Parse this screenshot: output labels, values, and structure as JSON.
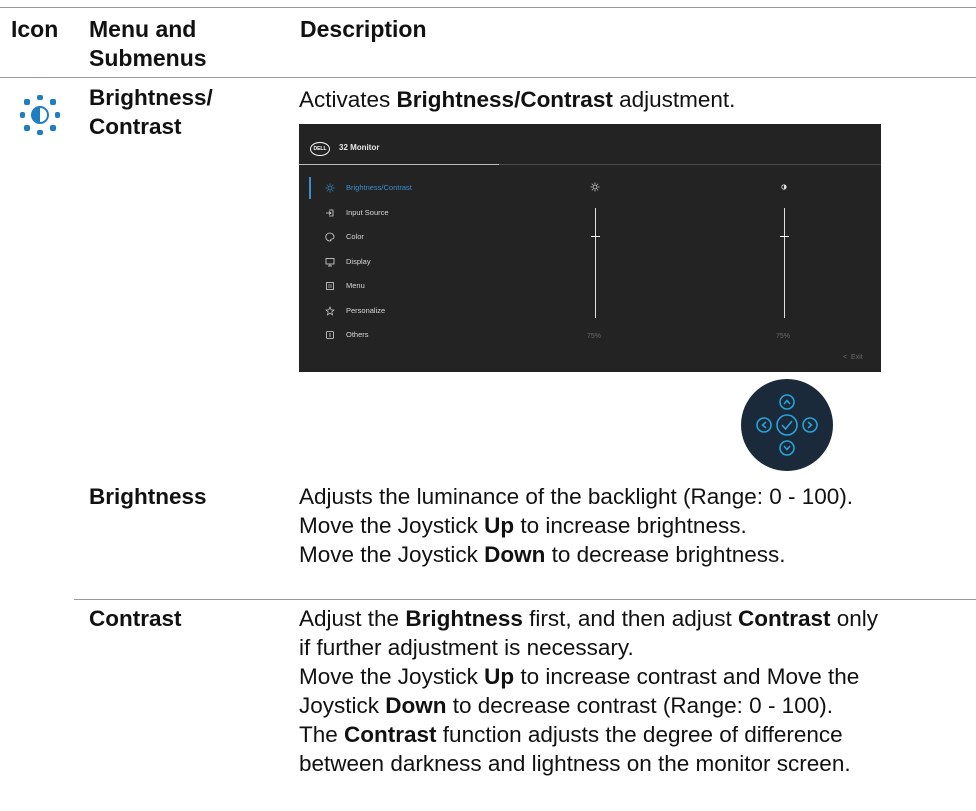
{
  "table": {
    "headers": {
      "icon": "Icon",
      "menu_line1": "Menu and",
      "menu_line2": "Submenus",
      "description": "Description"
    },
    "brightness_contrast": {
      "menu_line1": "Brightness/",
      "menu_line2": "Contrast",
      "desc_pre": "Activates ",
      "desc_bold": "Brightness/Contrast",
      "desc_post": " adjustment."
    },
    "brightness": {
      "label": "Brightness",
      "line1": "Adjusts the luminance of the backlight (Range: 0 - 100).",
      "line2_pre": "Move the Joystick ",
      "line2_bold": "Up",
      "line2_post": " to increase brightness.",
      "line3_pre": "Move the Joystick ",
      "line3_bold": "Down",
      "line3_post": " to decrease brightness."
    },
    "contrast": {
      "label": "Contrast",
      "l1_pre": "Adjust the ",
      "l1_b1": "Brightness",
      "l1_mid": " first, and then adjust ",
      "l1_b2": "Contrast",
      "l1_post": " only",
      "l2": "if further adjustment is necessary.",
      "l3_pre": "Move the Joystick ",
      "l3_bold": "Up",
      "l3_post": " to increase contrast and Move the",
      "l4_pre": "Joystick ",
      "l4_bold": "Down",
      "l4_post": " to decrease contrast (Range: 0 - 100).",
      "l5_pre": "The ",
      "l5_bold": "Contrast",
      "l5_post": " function adjusts the degree of difference",
      "l6": "between darkness and lightness on the monitor screen."
    }
  },
  "osd": {
    "logo": "DELL",
    "title": "32 Monitor",
    "menu": [
      {
        "label": "Brightness/Contrast",
        "icon": "sun-icon",
        "active": true
      },
      {
        "label": "Input Source",
        "icon": "input-source-icon",
        "active": false
      },
      {
        "label": "Color",
        "icon": "color-palette-icon",
        "active": false
      },
      {
        "label": "Display",
        "icon": "display-icon",
        "active": false
      },
      {
        "label": "Menu",
        "icon": "menu-icon",
        "active": false
      },
      {
        "label": "Personalize",
        "icon": "star-icon",
        "active": false
      },
      {
        "label": "Others",
        "icon": "others-icon",
        "active": false
      }
    ],
    "brightness_value": "75%",
    "contrast_value": "75%",
    "brightness_level": 75,
    "contrast_level": 75,
    "exit_label": "Exit",
    "accent_color": "#3a8fd0"
  },
  "colors": {
    "icon_blue": "#1f7ec2",
    "joystick_ring": "#2aa2d8",
    "joystick_bg": "#1a2a3a"
  }
}
